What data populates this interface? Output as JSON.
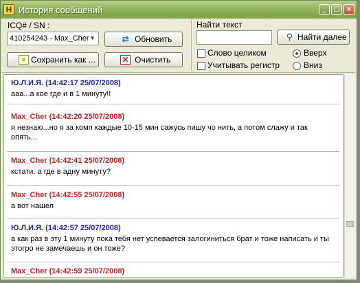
{
  "window": {
    "title": "История сообщений",
    "app_icon_letter": "H",
    "minimize_glyph": "_",
    "maximize_glyph": "□",
    "close_glyph": "×"
  },
  "contact": {
    "label": "ICQ# / SN :",
    "selected": "410254243 - Max_Cher"
  },
  "buttons": {
    "refresh": "Обновить",
    "save_as": "Сохранить как ...",
    "clear": "Очистить",
    "find_next": "Найти далее"
  },
  "search": {
    "label": "Найти текст",
    "value": "",
    "whole_word": "Слово целиком",
    "match_case": "Учитывать регистр",
    "direction_up": "Вверх",
    "direction_down": "Вниз",
    "direction_selected": "up"
  },
  "colors": {
    "self_name": "#1a22a8",
    "peer_name": "#c42020"
  },
  "messages": [
    {
      "sender": "Ю.Л.И.Я.",
      "time": "(14:42:17 25/07/2008)",
      "text": "ааа...а кое где и в 1 минуту!!",
      "side": "self"
    },
    {
      "sender": "Max_Cher",
      "time": "(14:42:20 25/07/2008)",
      "text": "я незнаю...но я за комп каждые 10-15 мин сажусь пишу чо нить, а потом слажу и так опять...",
      "side": "peer"
    },
    {
      "sender": "Max_Cher",
      "time": "(14:42:41 25/07/2008)",
      "text": "кстати, а где в адну минуту?",
      "side": "peer"
    },
    {
      "sender": "Max_Cher",
      "time": "(14:42:55 25/07/2008)",
      "text": "а вот нашел",
      "side": "peer"
    },
    {
      "sender": "Ю.Л.И.Я.",
      "time": "(14:42:57 25/07/2008)",
      "text": "а как раз в эту 1 минуту пока тебя нет успевается залогиниться брат и тоже написать и ты этогро не замечаешь и он тоже?",
      "side": "self"
    },
    {
      "sender": "Max_Cher",
      "time": "(14:42:59 25/07/2008)",
      "text": "",
      "side": "peer"
    }
  ]
}
